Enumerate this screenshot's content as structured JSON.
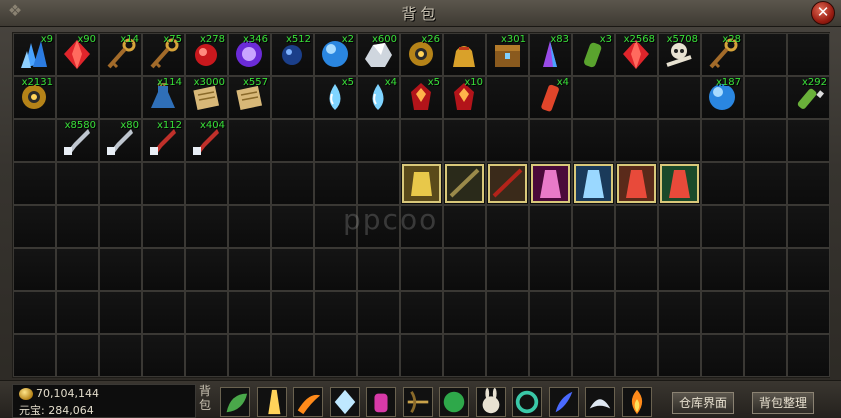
{
  "window": {
    "title": "背包",
    "close_label": "✕"
  },
  "watermark": "ppcoo",
  "colors": {
    "quantity": "#38e038",
    "equip_border": "#d9c87a"
  },
  "inventory": {
    "columns": 19,
    "rows": 8,
    "items": [
      {
        "row": 0,
        "col": 0,
        "icon": "blue-crystal-cluster-icon",
        "qty": "x9"
      },
      {
        "row": 0,
        "col": 1,
        "icon": "red-gem-icon",
        "qty": "x90"
      },
      {
        "row": 0,
        "col": 2,
        "icon": "golden-key-icon",
        "qty": "x14"
      },
      {
        "row": 0,
        "col": 3,
        "icon": "golden-key-icon",
        "qty": "x75"
      },
      {
        "row": 0,
        "col": 4,
        "icon": "red-orb-icon",
        "qty": "x278"
      },
      {
        "row": 0,
        "col": 5,
        "icon": "purple-orb-icon",
        "qty": "x346"
      },
      {
        "row": 0,
        "col": 6,
        "icon": "blue-orb-icon",
        "qty": "x512"
      },
      {
        "row": 0,
        "col": 7,
        "icon": "blue-sphere-icon",
        "qty": "x2"
      },
      {
        "row": 0,
        "col": 8,
        "icon": "silver-ore-icon",
        "qty": "x600"
      },
      {
        "row": 0,
        "col": 9,
        "icon": "golden-gear-icon",
        "qty": "x26"
      },
      {
        "row": 0,
        "col": 10,
        "icon": "gold-bag-icon",
        "qty": ""
      },
      {
        "row": 0,
        "col": 11,
        "icon": "treasure-chest-icon",
        "qty": "x301"
      },
      {
        "row": 0,
        "col": 12,
        "icon": "purple-crystal-icon",
        "qty": "x83"
      },
      {
        "row": 0,
        "col": 13,
        "icon": "green-vial-icon",
        "qty": "x3"
      },
      {
        "row": 0,
        "col": 14,
        "icon": "red-gem-icon",
        "qty": "x2568"
      },
      {
        "row": 0,
        "col": 15,
        "icon": "skull-bones-icon",
        "qty": "x5708"
      },
      {
        "row": 0,
        "col": 16,
        "icon": "golden-key-icon",
        "qty": "x28"
      },
      {
        "row": 1,
        "col": 0,
        "icon": "golden-gear-icon",
        "qty": "x2131"
      },
      {
        "row": 1,
        "col": 3,
        "icon": "blue-potion-icon",
        "qty": "x114"
      },
      {
        "row": 1,
        "col": 4,
        "icon": "scroll-icon",
        "qty": "x3000"
      },
      {
        "row": 1,
        "col": 5,
        "icon": "scroll-icon",
        "qty": "x557"
      },
      {
        "row": 1,
        "col": 7,
        "icon": "water-drop-icon",
        "qty": "x5"
      },
      {
        "row": 1,
        "col": 8,
        "icon": "water-drop-icon",
        "qty": "x4"
      },
      {
        "row": 1,
        "col": 9,
        "icon": "red-rune-icon",
        "qty": "x5"
      },
      {
        "row": 1,
        "col": 10,
        "icon": "red-rune-icon",
        "qty": "x10"
      },
      {
        "row": 1,
        "col": 12,
        "icon": "red-vial-icon",
        "qty": "x4"
      },
      {
        "row": 1,
        "col": 16,
        "icon": "blue-sphere-icon",
        "qty": "x187"
      },
      {
        "row": 1,
        "col": 18,
        "icon": "green-bottle-icon",
        "qty": "x292"
      },
      {
        "row": 2,
        "col": 1,
        "icon": "silver-pipe-icon",
        "qty": "x8580"
      },
      {
        "row": 2,
        "col": 2,
        "icon": "silver-pipe-icon",
        "qty": "x80"
      },
      {
        "row": 2,
        "col": 3,
        "icon": "red-pipe-icon",
        "qty": "x112"
      },
      {
        "row": 2,
        "col": 4,
        "icon": "red-pipe-icon",
        "qty": "x404"
      }
    ],
    "equipment": [
      {
        "row": 3,
        "col": 9,
        "icon": "golden-armor-icon"
      },
      {
        "row": 3,
        "col": 10,
        "icon": "dark-sword-icon"
      },
      {
        "row": 3,
        "col": 11,
        "icon": "red-sword-icon"
      },
      {
        "row": 3,
        "col": 12,
        "icon": "pink-robe-icon"
      },
      {
        "row": 3,
        "col": 13,
        "icon": "blue-mage-icon"
      },
      {
        "row": 3,
        "col": 14,
        "icon": "red-warrior-icon"
      },
      {
        "row": 3,
        "col": 15,
        "icon": "red-warrior-green-icon"
      }
    ]
  },
  "currency": {
    "gold": "70,104,144",
    "yuanbao_label": "元宝:",
    "yuanbao": "284,064"
  },
  "bottom_bar": {
    "bag_label": "背包",
    "skills": [
      "green-leaf-icon",
      "golden-beam-icon",
      "fire-slash-icon",
      "ice-crystal-icon",
      "pink-potion-icon",
      "crossbow-icon",
      "green-orb-icon",
      "rabbit-icon",
      "jade-ring-icon",
      "blue-feather-icon",
      "silver-wing-icon",
      "flame-icon"
    ],
    "warehouse_button": "仓库界面",
    "sort_button": "背包整理"
  }
}
